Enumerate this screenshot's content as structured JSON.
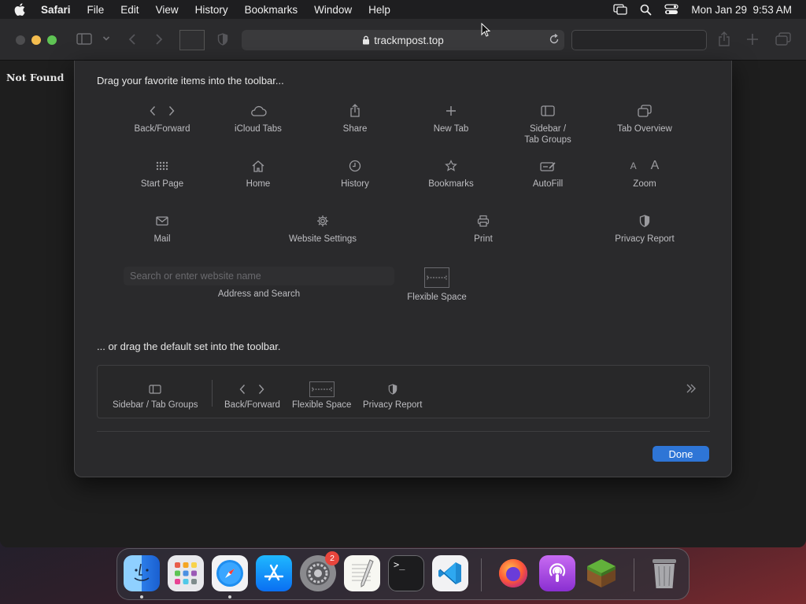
{
  "menubar": {
    "app_name": "Safari",
    "items": [
      "File",
      "Edit",
      "View",
      "History",
      "Bookmarks",
      "Window",
      "Help"
    ],
    "datetime": "Mon Jan 29  9:53 AM"
  },
  "browser": {
    "url": "trackmpost.top",
    "page_text": "Not Found"
  },
  "customize": {
    "heading": "Drag your favorite items into the toolbar...",
    "items": [
      {
        "label": "Back/Forward",
        "icon": "back-forward-icon"
      },
      {
        "label": "iCloud Tabs",
        "icon": "cloud-icon"
      },
      {
        "label": "Share",
        "icon": "share-icon"
      },
      {
        "label": "New Tab",
        "icon": "plus-icon"
      },
      {
        "label": "Sidebar /",
        "label2": "Tab Groups",
        "icon": "sidebar-icon"
      },
      {
        "label": "Tab Overview",
        "icon": "tab-overview-icon"
      },
      {
        "label": "Start Page",
        "icon": "grid-icon"
      },
      {
        "label": "Home",
        "icon": "home-icon"
      },
      {
        "label": "History",
        "icon": "clock-icon"
      },
      {
        "label": "Bookmarks",
        "icon": "star-icon"
      },
      {
        "label": "AutoFill",
        "icon": "autofill-icon"
      },
      {
        "label": "Zoom",
        "icon": "zoom-icon",
        "small_a": "A",
        "large_a": "A"
      },
      {
        "label": "Mail",
        "icon": "mail-icon"
      },
      {
        "label": "Website Settings",
        "icon": "gear-icon"
      },
      {
        "label": "Print",
        "icon": "printer-icon"
      },
      {
        "label": "Privacy Report",
        "icon": "shield-icon"
      }
    ],
    "address_field_placeholder": "Search or enter website name",
    "address_label": "Address and Search",
    "flexible_space_label": "Flexible Space",
    "default_heading": "... or drag the default set into the toolbar.",
    "default_set": [
      {
        "label": "Sidebar / Tab Groups",
        "icon": "sidebar-icon"
      },
      {
        "label": "Back/Forward",
        "icon": "back-forward-icon"
      },
      {
        "label": "Flexible Space",
        "icon": "flexible-space-icon"
      },
      {
        "label": "Privacy Report",
        "icon": "shield-icon"
      }
    ],
    "done_label": "Done"
  },
  "dock": {
    "apps": [
      {
        "name": "Finder",
        "icon": "finder-icon"
      },
      {
        "name": "Launchpad",
        "icon": "launchpad-icon"
      },
      {
        "name": "Safari",
        "icon": "safari-icon"
      },
      {
        "name": "App Store",
        "icon": "app-store-icon"
      },
      {
        "name": "System Preferences",
        "icon": "system-preferences-icon",
        "badge": "2"
      },
      {
        "name": "TextEdit",
        "icon": "textedit-icon"
      },
      {
        "name": "Terminal",
        "icon": "terminal-icon",
        "glyph": ">_"
      },
      {
        "name": "Visual Studio Code",
        "icon": "vscode-icon"
      },
      {
        "name": "Firefox",
        "icon": "firefox-icon"
      },
      {
        "name": "Podcasts",
        "icon": "podcasts-icon"
      },
      {
        "name": "Minecraft",
        "icon": "minecraft-icon"
      },
      {
        "name": "Trash",
        "icon": "trash-icon"
      }
    ]
  },
  "colors": {
    "accent": "#2e75d6",
    "badge": "#e8453c",
    "traffic_close": "#4d4d4f",
    "traffic_min": "#f4bd4f",
    "traffic_max": "#5fc454"
  }
}
